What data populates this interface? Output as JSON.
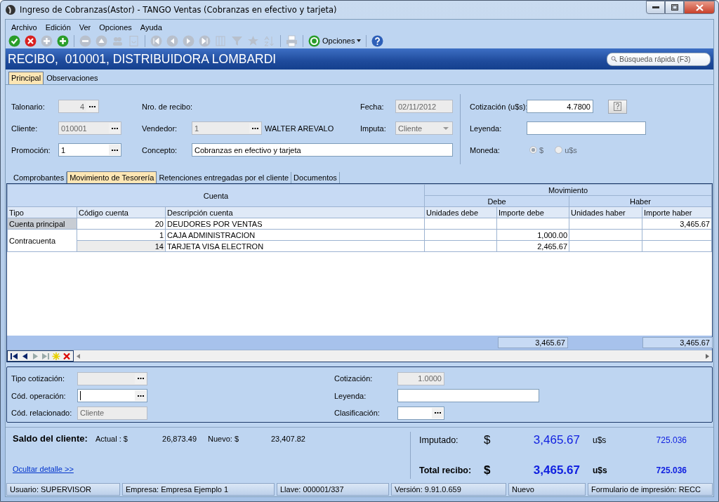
{
  "window": {
    "title": "Ingreso de Cobranzas(Astor) - TANGO Ventas (Cobranzas en efectivo y tarjeta)"
  },
  "menu": [
    "Archivo",
    "Edición",
    "Ver",
    "Opciones",
    "Ayuda"
  ],
  "toolbar": {
    "tool_groups": [
      [
        {
          "kind": "accept",
          "disabled": false
        },
        {
          "kind": "cancel",
          "disabled": false
        },
        {
          "kind": "add",
          "disabled": true
        },
        {
          "kind": "add",
          "disabled": false
        }
      ],
      [
        {
          "kind": "remove",
          "disabled": true
        },
        {
          "kind": "up",
          "disabled": true
        },
        {
          "kind": "users",
          "disabled": true
        },
        {
          "kind": "document",
          "disabled": true
        }
      ],
      [
        {
          "kind": "first",
          "disabled": true
        },
        {
          "kind": "previous",
          "disabled": true
        },
        {
          "kind": "next",
          "disabled": true
        },
        {
          "kind": "last",
          "disabled": true
        },
        {
          "kind": "columns",
          "disabled": true
        },
        {
          "kind": "filter",
          "disabled": true
        },
        {
          "kind": "favorite",
          "disabled": true
        },
        {
          "kind": "sort",
          "disabled": true
        }
      ],
      [
        {
          "kind": "print",
          "disabled": true
        }
      ]
    ],
    "options_button": "Opciones"
  },
  "record": {
    "title": "RECIBO,  010001, DISTRIBUIDORA LOMBARDI",
    "search_placeholder": "Búsqueda rápida (F3)"
  },
  "tabs": [
    {
      "label": "Principal",
      "selected": true
    },
    {
      "label": "Observaciones",
      "selected": false
    }
  ],
  "form": {
    "talonario": {
      "label": "Talonario:",
      "value": "4",
      "disabled": true
    },
    "nro_recibo": {
      "label": "Nro. de recibo:"
    },
    "fecha": {
      "label": "Fecha:",
      "value": "02/11/2012",
      "disabled": true
    },
    "cliente": {
      "label": "Cliente:",
      "value": "010001",
      "disabled": true
    },
    "vendedor": {
      "label": "Vendedor:",
      "value": "1",
      "disabled": true,
      "name": "WALTER AREVALO"
    },
    "imputa": {
      "label": "Imputa:",
      "value": "Cliente",
      "disabled": true
    },
    "promocion": {
      "label": "Promoción:",
      "value": "1",
      "disabled": false
    },
    "concepto": {
      "label": "Concepto:",
      "value": "Cobranzas en efectivo y tarjeta"
    },
    "cotizacion": {
      "label": "Cotización (u$s):",
      "value": "4.7800"
    },
    "leyenda": {
      "label": "Leyenda:"
    },
    "moneda": {
      "label": "Moneda:",
      "disabled": true,
      "options": [
        {
          "label": "$",
          "selected": true
        },
        {
          "label": "u$s",
          "selected": false
        }
      ]
    }
  },
  "subtabs": [
    {
      "label": "Comprobantes",
      "selected": false
    },
    {
      "label": "Movimiento de Tesorería",
      "selected": true
    },
    {
      "label": "Retenciones entregadas por el cliente",
      "selected": false
    },
    {
      "label": "Documentos",
      "selected": false
    }
  ],
  "grid": {
    "group_header": "Cuenta",
    "movement_header": "Movimiento",
    "debit_header": "Debe",
    "credit_header": "Haber",
    "columns": [
      "Tipo",
      "Código cuenta",
      "Descripción cuenta",
      "Unidades debe",
      "Importe debe",
      "Unidades haber",
      "Importe haber"
    ],
    "groups": [
      {
        "tipo": "Cuenta principal",
        "selected": true,
        "rows": [
          {
            "codigo": "20",
            "descripcion": "DEUDORES POR VENTAS",
            "shaded": false,
            "importe_haber": "3,465.67"
          }
        ]
      },
      {
        "tipo": "Contracuenta",
        "selected": false,
        "rows": [
          {
            "codigo": "1",
            "descripcion": "CAJA ADMINISTRACION",
            "shaded": false,
            "importe_debe": "1,000.00"
          },
          {
            "codigo": "14",
            "descripcion": "TARJETA VISA ELECTRON",
            "shaded": true,
            "importe_debe": "2,465.67"
          }
        ]
      }
    ],
    "totals": {
      "importe_debe": "3,465.67",
      "importe_haber": "3,465.67"
    }
  },
  "detail": {
    "tipo_cotizacion": {
      "label": "Tipo cotización:",
      "disabled": true
    },
    "cod_operacion": {
      "label": "Cód. operación:",
      "disabled": false
    },
    "cod_relacionado": {
      "label": "Cód. relacionado:",
      "value": "Cliente",
      "disabled": true
    },
    "cotizacion": {
      "label": "Cotización:",
      "value": "1.0000",
      "disabled": true
    },
    "leyenda": {
      "label": "Leyenda:"
    },
    "clasificacion": {
      "label": "Clasificación:"
    }
  },
  "summary": {
    "saldo_label": "Saldo del cliente:",
    "actual_label": "Actual : $",
    "actual": "26,873.49",
    "nuevo_label": "Nuevo: $",
    "nuevo": "23,407.82",
    "link": "Ocultar detalle >>",
    "lines": [
      {
        "kind": "plain",
        "label": "Imputado:",
        "currency": "$",
        "amount": "3,465.67",
        "usd_label": "u$s",
        "usd": "725.036"
      },
      {
        "kind": "bold",
        "label": "Total recibo:",
        "currency": "$",
        "amount": "3,465.67",
        "usd_label": "u$s",
        "usd": "725.036"
      }
    ]
  },
  "status_bar": [
    "Usuario: SUPERVISOR",
    "Empresa: Empresa Ejemplo 1",
    "Llave: 000001/337",
    "Versión: 9.91.0.659",
    "Nuevo",
    "Formulario de impresión: RECC"
  ]
}
